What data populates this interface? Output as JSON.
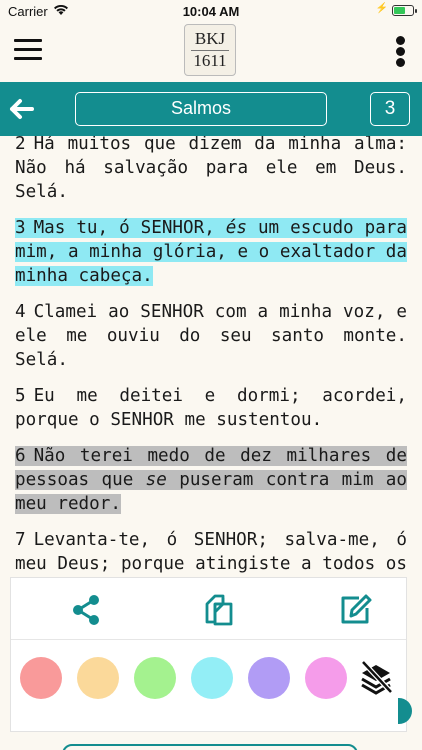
{
  "status": {
    "carrier": "Carrier",
    "time": "10:04 AM",
    "battery_level": 0.6
  },
  "header": {
    "logo_line1": "BKJ",
    "logo_line2": "1611"
  },
  "nav": {
    "book": "Salmos",
    "chapter": "3"
  },
  "verses": [
    {
      "number": "2",
      "text": "Há muitos que dizem da minha alma: Não há salvação para ele em Deus. Selá.",
      "highlight": ""
    },
    {
      "number": "3",
      "text_before": "Mas tu, ó SENHOR, ",
      "text_italic": "és",
      "text_after": " um escudo para mim, a minha glória, e o exaltador da minha cabeça.",
      "highlight": "#8fe9f3"
    },
    {
      "number": "4",
      "text": "Clamei ao SENHOR com a minha voz, e ele me ouviu do seu santo monte. Selá.",
      "highlight": ""
    },
    {
      "number": "5",
      "text": "Eu me deitei e dormi; acordei, porque o SENHOR me sustentou.",
      "highlight": ""
    },
    {
      "number": "6",
      "text_before": "Não terei medo de dez milhares de pessoas que ",
      "text_italic": "se",
      "text_after": " puseram contra mim ao meu redor.",
      "highlight": "#bdbdbd"
    },
    {
      "number": "7",
      "text": "Levanta-te, ó SENHOR; salva-me, ó meu Deus; porque atingiste a todos os meus inimigos no queixo;",
      "highlight": ""
    }
  ],
  "actions": {
    "share_icon": "share-icon",
    "copy_icon": "copy-icon",
    "note_icon": "edit-note-icon"
  },
  "highlight_colors": [
    "#f99a9a",
    "#fbd99a",
    "#a4f28f",
    "#93eef6",
    "#b19cf5",
    "#f59cea"
  ],
  "accent": "#138d8f"
}
